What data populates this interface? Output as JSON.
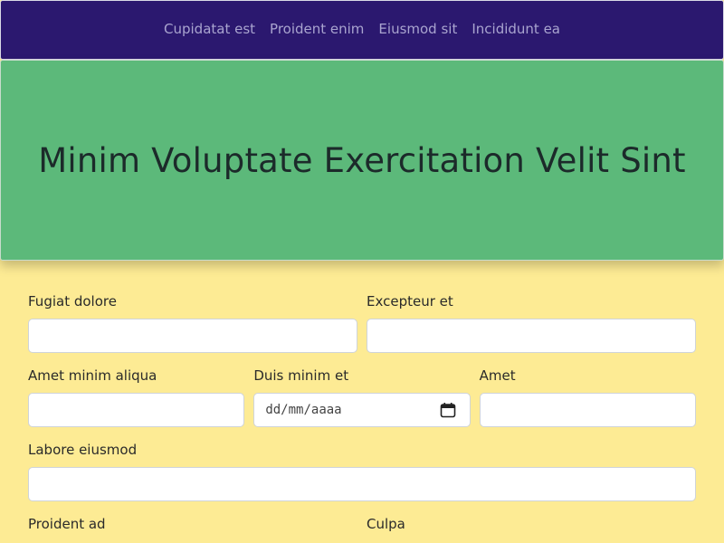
{
  "nav": {
    "links": [
      "Cupidatat est",
      "Proident enim",
      "Eiusmod sit",
      "Incididunt ea"
    ]
  },
  "hero": {
    "title": "Minim Voluptate Exercitation Velit Sint"
  },
  "form": {
    "row1": [
      {
        "label": "Fugiat dolore",
        "value": ""
      },
      {
        "label": "Excepteur et",
        "value": ""
      }
    ],
    "row2": [
      {
        "label": "Amet minim aliqua",
        "value": ""
      },
      {
        "label": "Duis minim et",
        "value": "dd/mm/aaaa"
      },
      {
        "label": "Amet",
        "value": ""
      }
    ],
    "row3": [
      {
        "label": "Labore eiusmod",
        "value": ""
      }
    ],
    "row4": [
      {
        "label": "Proident ad"
      },
      {
        "label": "Culpa"
      }
    ]
  },
  "colors": {
    "page_bg": "#fdeb94",
    "nav_bg": "#2b186f",
    "hero_bg": "#5cb97a"
  },
  "icons": {
    "date_picker": "calendar-icon"
  }
}
